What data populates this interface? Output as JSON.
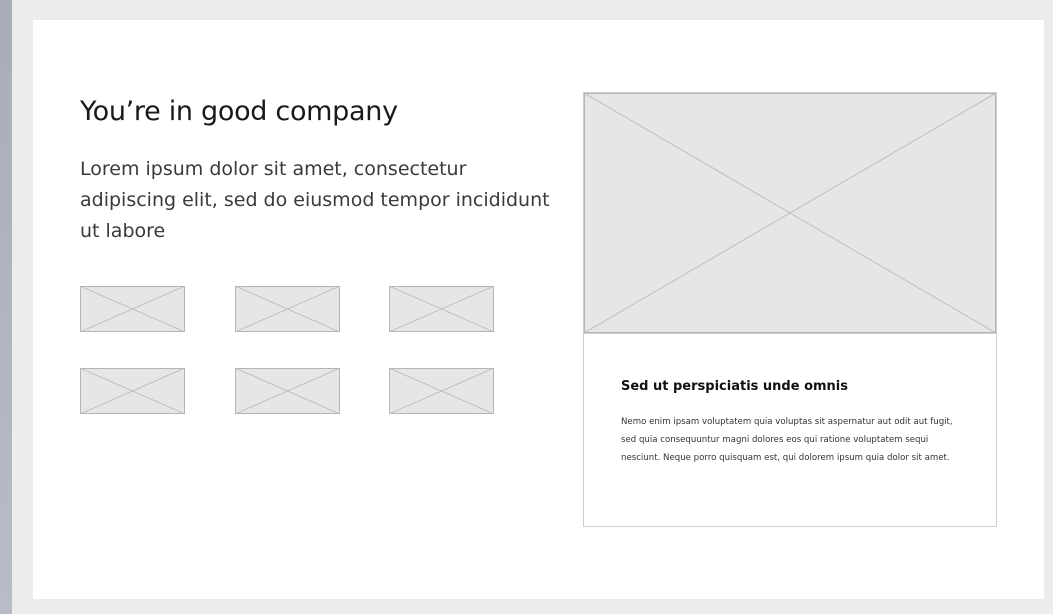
{
  "section": {
    "headline": "You’re in good company",
    "intro": "Lorem ipsum dolor sit amet, consectetur adipiscing elit, sed do eiusmod tempor incididunt ut labore"
  },
  "logos": [
    {
      "name": "image-placeholder-icon"
    },
    {
      "name": "image-placeholder-icon"
    },
    {
      "name": "image-placeholder-icon"
    },
    {
      "name": "image-placeholder-icon"
    },
    {
      "name": "image-placeholder-icon"
    },
    {
      "name": "image-placeholder-icon"
    }
  ],
  "card": {
    "image": "image-placeholder-icon",
    "title": "Sed ut perspiciatis unde omnis",
    "body": "Nemo enim ipsam voluptatem quia voluptas sit aspernatur aut odit aut fugit, sed quia consequuntur magni dolores eos qui ratione voluptatem sequi nesciunt. Neque porro quisquam est, qui dolorem ipsum quia dolor sit amet."
  },
  "colors": {
    "placeholder_fill": "#e6e6e6",
    "placeholder_stroke": "#b5b5b5",
    "panel": "#ffffff",
    "backdrop": "#ececec"
  }
}
